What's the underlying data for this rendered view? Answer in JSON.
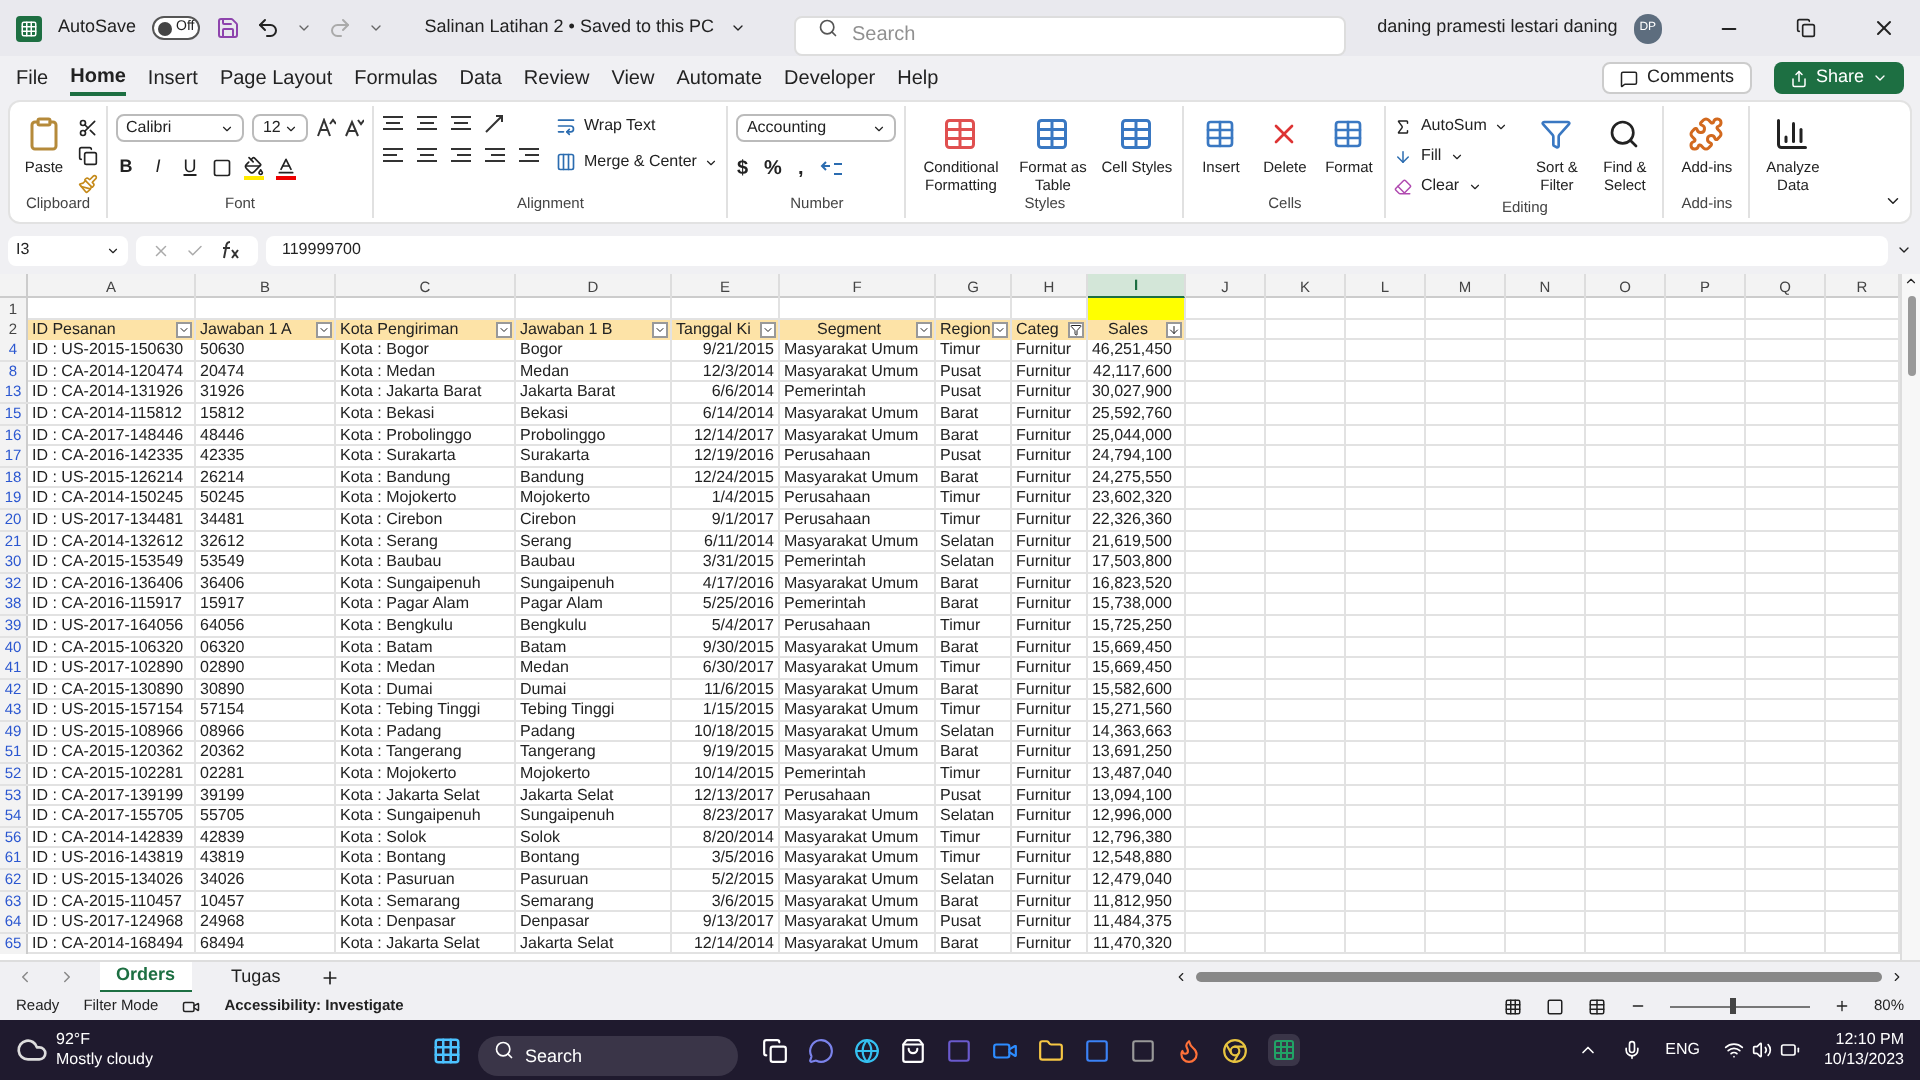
{
  "titlebar": {
    "autosave_label": "AutoSave",
    "autosave": {
      "on": false,
      "label": "Off"
    },
    "doc_title": "Salinan Latihan 2 • Saved to this PC",
    "search_placeholder": "Search",
    "user": "daning pramesti lestari daning",
    "avatar": "DP"
  },
  "menu_tabs": [
    {
      "label": "File",
      "selected": false
    },
    {
      "label": "Home",
      "selected": true
    },
    {
      "label": "Insert",
      "selected": false
    },
    {
      "label": "Page Layout",
      "selected": false
    },
    {
      "label": "Formulas",
      "selected": false
    },
    {
      "label": "Data",
      "selected": false
    },
    {
      "label": "Review",
      "selected": false
    },
    {
      "label": "View",
      "selected": false
    },
    {
      "label": "Automate",
      "selected": false
    },
    {
      "label": "Developer",
      "selected": false
    },
    {
      "label": "Help",
      "selected": false
    }
  ],
  "comments": "Comments",
  "share": "Share",
  "ribbon": {
    "clipboard": {
      "label": "Clipboard",
      "paste": "Paste"
    },
    "font": {
      "label": "Font",
      "face": "Calibri",
      "size": "12",
      "styles": [
        "B",
        "I",
        "U"
      ]
    },
    "alignment": {
      "label": "Alignment",
      "wrap": "Wrap Text",
      "merge": "Merge & Center"
    },
    "number": {
      "label": "Number",
      "format": "Accounting",
      "symbols": [
        "$",
        "%",
        ","
      ]
    },
    "styles": {
      "label": "Styles",
      "buttons": [
        "Conditional Formatting",
        "Format as Table",
        "Cell Styles"
      ]
    },
    "cells": {
      "label": "Cells",
      "buttons": [
        "Insert",
        "Delete",
        "Format"
      ]
    },
    "editing": {
      "label": "Editing",
      "autosum": "AutoSum",
      "fill": "Fill",
      "clear": "Clear",
      "buttons": [
        "Sort & Filter",
        "Find & Select"
      ]
    },
    "addins": {
      "label": "Add-ins",
      "button": "Add-ins"
    },
    "analyze": {
      "button": "Analyze Data"
    }
  },
  "formula_bar": {
    "name_box": "I3",
    "formula": "119999700"
  },
  "columns": [
    {
      "letter": "A",
      "selected": false
    },
    {
      "letter": "B",
      "selected": false
    },
    {
      "letter": "C",
      "selected": false
    },
    {
      "letter": "D",
      "selected": false
    },
    {
      "letter": "E",
      "selected": false
    },
    {
      "letter": "F",
      "selected": false
    },
    {
      "letter": "G",
      "selected": false
    },
    {
      "letter": "H",
      "selected": false
    },
    {
      "letter": "I",
      "selected": true
    },
    {
      "letter": "J",
      "selected": false
    },
    {
      "letter": "K",
      "selected": false
    },
    {
      "letter": "L",
      "selected": false
    },
    {
      "letter": "M",
      "selected": false
    },
    {
      "letter": "N",
      "selected": false
    },
    {
      "letter": "O",
      "selected": false
    },
    {
      "letter": "P",
      "selected": false
    },
    {
      "letter": "Q",
      "selected": false
    },
    {
      "letter": "R",
      "selected": false
    }
  ],
  "table": {
    "blank_row": "1",
    "header_row": "2",
    "headers": [
      {
        "label": "ID Pesanan",
        "filtered": false,
        "sorted": false
      },
      {
        "label": "Jawaban 1 A",
        "filtered": false,
        "sorted": false
      },
      {
        "label": "Kota Pengiriman",
        "filtered": false,
        "sorted": false
      },
      {
        "label": "Jawaban 1 B",
        "filtered": false,
        "sorted": false
      },
      {
        "label": "Tanggal Ki",
        "filtered": false,
        "sorted": false
      },
      {
        "label": "Segment",
        "filtered": false,
        "sorted": false
      },
      {
        "label": "Region",
        "filtered": false,
        "sorted": false
      },
      {
        "label": "Categ",
        "filtered": true,
        "sorted": false
      },
      {
        "label": "Sales",
        "filtered": false,
        "sorted": true
      }
    ],
    "rows": [
      {
        "row": "4",
        "cells": [
          "ID : US-2015-150630",
          "50630",
          "Kota : Bogor",
          "Bogor",
          "9/21/2015",
          "Masyarakat Umum",
          "Timur",
          "Furnitur",
          "46,251,450"
        ]
      },
      {
        "row": "8",
        "cells": [
          "ID : CA-2014-120474",
          "20474",
          "Kota : Medan",
          "Medan",
          "12/3/2014",
          "Masyarakat Umum",
          "Pusat",
          "Furnitur",
          "42,117,600"
        ]
      },
      {
        "row": "13",
        "cells": [
          "ID : CA-2014-131926",
          "31926",
          "Kota : Jakarta Barat",
          "Jakarta Barat",
          "6/6/2014",
          "Pemerintah",
          "Pusat",
          "Furnitur",
          "30,027,900"
        ]
      },
      {
        "row": "15",
        "cells": [
          "ID : CA-2014-115812",
          "15812",
          "Kota : Bekasi",
          "Bekasi",
          "6/14/2014",
          "Masyarakat Umum",
          "Barat",
          "Furnitur",
          "25,592,760"
        ]
      },
      {
        "row": "16",
        "cells": [
          "ID : CA-2017-148446",
          "48446",
          "Kota : Probolinggo",
          "Probolinggo",
          "12/14/2017",
          "Masyarakat Umum",
          "Barat",
          "Furnitur",
          "25,044,000"
        ]
      },
      {
        "row": "17",
        "cells": [
          "ID : CA-2016-142335",
          "42335",
          "Kota : Surakarta",
          "Surakarta",
          "12/19/2016",
          "Perusahaan",
          "Pusat",
          "Furnitur",
          "24,794,100"
        ]
      },
      {
        "row": "18",
        "cells": [
          "ID : US-2015-126214",
          "26214",
          "Kota : Bandung",
          "Bandung",
          "12/24/2015",
          "Masyarakat Umum",
          "Barat",
          "Furnitur",
          "24,275,550"
        ]
      },
      {
        "row": "19",
        "cells": [
          "ID : CA-2014-150245",
          "50245",
          "Kota : Mojokerto",
          "Mojokerto",
          "1/4/2015",
          "Perusahaan",
          "Timur",
          "Furnitur",
          "23,602,320"
        ]
      },
      {
        "row": "20",
        "cells": [
          "ID : US-2017-134481",
          "34481",
          "Kota : Cirebon",
          "Cirebon",
          "9/1/2017",
          "Perusahaan",
          "Timur",
          "Furnitur",
          "22,326,360"
        ]
      },
      {
        "row": "21",
        "cells": [
          "ID : CA-2014-132612",
          "32612",
          "Kota : Serang",
          "Serang",
          "6/11/2014",
          "Masyarakat Umum",
          "Selatan",
          "Furnitur",
          "21,619,500"
        ]
      },
      {
        "row": "30",
        "cells": [
          "ID : CA-2015-153549",
          "53549",
          "Kota : Baubau",
          "Baubau",
          "3/31/2015",
          "Pemerintah",
          "Selatan",
          "Furnitur",
          "17,503,800"
        ]
      },
      {
        "row": "32",
        "cells": [
          "ID : CA-2016-136406",
          "36406",
          "Kota : Sungaipenuh",
          "Sungaipenuh",
          "4/17/2016",
          "Masyarakat Umum",
          "Barat",
          "Furnitur",
          "16,823,520"
        ]
      },
      {
        "row": "38",
        "cells": [
          "ID : CA-2016-115917",
          "15917",
          "Kota : Pagar Alam",
          "Pagar Alam",
          "5/25/2016",
          "Pemerintah",
          "Barat",
          "Furnitur",
          "15,738,000"
        ]
      },
      {
        "row": "39",
        "cells": [
          "ID : US-2017-164056",
          "64056",
          "Kota : Bengkulu",
          "Bengkulu",
          "5/4/2017",
          "Perusahaan",
          "Timur",
          "Furnitur",
          "15,725,250"
        ]
      },
      {
        "row": "40",
        "cells": [
          "ID : CA-2015-106320",
          "06320",
          "Kota : Batam",
          "Batam",
          "9/30/2015",
          "Masyarakat Umum",
          "Barat",
          "Furnitur",
          "15,669,450"
        ]
      },
      {
        "row": "41",
        "cells": [
          "ID : US-2017-102890",
          "02890",
          "Kota : Medan",
          "Medan",
          "6/30/2017",
          "Masyarakat Umum",
          "Timur",
          "Furnitur",
          "15,669,450"
        ]
      },
      {
        "row": "42",
        "cells": [
          "ID : CA-2015-130890",
          "30890",
          "Kota : Dumai",
          "Dumai",
          "11/6/2015",
          "Masyarakat Umum",
          "Barat",
          "Furnitur",
          "15,582,600"
        ]
      },
      {
        "row": "43",
        "cells": [
          "ID : US-2015-157154",
          "57154",
          "Kota : Tebing Tinggi",
          "Tebing Tinggi",
          "1/15/2015",
          "Masyarakat Umum",
          "Timur",
          "Furnitur",
          "15,271,560"
        ]
      },
      {
        "row": "49",
        "cells": [
          "ID : US-2015-108966",
          "08966",
          "Kota : Padang",
          "Padang",
          "10/18/2015",
          "Masyarakat Umum",
          "Selatan",
          "Furnitur",
          "14,363,663"
        ]
      },
      {
        "row": "51",
        "cells": [
          "ID : CA-2015-120362",
          "20362",
          "Kota : Tangerang",
          "Tangerang",
          "9/19/2015",
          "Masyarakat Umum",
          "Barat",
          "Furnitur",
          "13,691,250"
        ]
      },
      {
        "row": "52",
        "cells": [
          "ID : CA-2015-102281",
          "02281",
          "Kota : Mojokerto",
          "Mojokerto",
          "10/14/2015",
          "Pemerintah",
          "Timur",
          "Furnitur",
          "13,487,040"
        ]
      },
      {
        "row": "53",
        "cells": [
          "ID : CA-2017-139199",
          "39199",
          "Kota : Jakarta Selat",
          "Jakarta Selat",
          "12/13/2017",
          "Perusahaan",
          "Pusat",
          "Furnitur",
          "13,094,100"
        ]
      },
      {
        "row": "54",
        "cells": [
          "ID : CA-2017-155705",
          "55705",
          "Kota : Sungaipenuh",
          "Sungaipenuh",
          "8/23/2017",
          "Masyarakat Umum",
          "Selatan",
          "Furnitur",
          "12,996,000"
        ]
      },
      {
        "row": "56",
        "cells": [
          "ID : CA-2014-142839",
          "42839",
          "Kota : Solok",
          "Solok",
          "8/20/2014",
          "Masyarakat Umum",
          "Timur",
          "Furnitur",
          "12,796,380"
        ]
      },
      {
        "row": "61",
        "cells": [
          "ID : US-2016-143819",
          "43819",
          "Kota : Bontang",
          "Bontang",
          "3/5/2016",
          "Masyarakat Umum",
          "Timur",
          "Furnitur",
          "12,548,880"
        ]
      },
      {
        "row": "62",
        "cells": [
          "ID : US-2015-134026",
          "34026",
          "Kota : Pasuruan",
          "Pasuruan",
          "5/2/2015",
          "Masyarakat Umum",
          "Selatan",
          "Furnitur",
          "12,479,040"
        ]
      },
      {
        "row": "63",
        "cells": [
          "ID : CA-2015-110457",
          "10457",
          "Kota : Semarang",
          "Semarang",
          "3/6/2015",
          "Masyarakat Umum",
          "Barat",
          "Furnitur",
          "11,812,950"
        ]
      },
      {
        "row": "64",
        "cells": [
          "ID : US-2017-124968",
          "24968",
          "Kota : Denpasar",
          "Denpasar",
          "9/13/2017",
          "Masyarakat Umum",
          "Pusat",
          "Furnitur",
          "11,484,375"
        ]
      },
      {
        "row": "65",
        "cells": [
          "ID : CA-2014-168494",
          "68494",
          "Kota : Jakarta Selat",
          "Jakarta Selat",
          "12/14/2014",
          "Masyarakat Umum",
          "Barat",
          "Furnitur",
          "11,470,320"
        ]
      }
    ]
  },
  "sheet_tabs": [
    {
      "label": "Orders",
      "selected": true
    },
    {
      "label": "Tugas",
      "selected": false
    }
  ],
  "status_bar": {
    "ready": "Ready",
    "mode": "Filter Mode",
    "accessibility": "Accessibility: Investigate",
    "zoom": "80%",
    "zoom_slider": {
      "level": 0.45
    }
  },
  "taskbar": {
    "temp": "92°F",
    "weather": "Mostly cloudy",
    "search_placeholder": "Search",
    "lang": "ENG",
    "time": "12:10 PM",
    "date": "10/13/2023"
  }
}
